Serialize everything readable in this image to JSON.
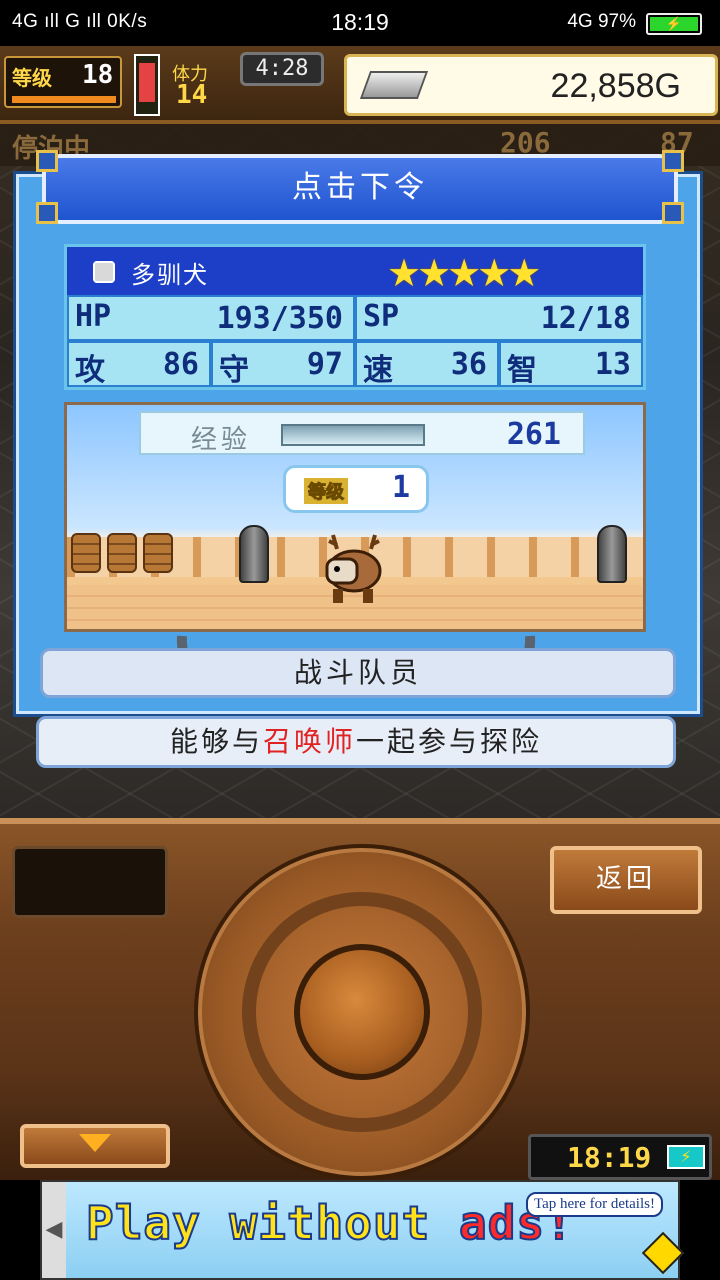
{
  "status_bar": {
    "left": "4G ıll G ıll 0K/s",
    "time": "18:19",
    "right": "4G 97%",
    "battery_icon": "battery-charging-icon"
  },
  "hud": {
    "level_label": "等级",
    "level": "18",
    "stamina_label": "体力",
    "stamina": "14",
    "timer": "4:28",
    "gold": "22,858G",
    "sub_left": "停泊中",
    "sub_mid": "206",
    "sub_right": "87"
  },
  "dialog": {
    "title": "点击下令",
    "unit_name": "多驯犬",
    "stars": "★★★★★",
    "stats": {
      "hp_label": "HP",
      "hp": "193/350",
      "sp_label": "SP",
      "sp": "12/18",
      "atk_label": "攻",
      "atk": "86",
      "def_label": "守",
      "def": "97",
      "spd_label": "速",
      "spd": "36",
      "int_label": "智",
      "int": "13"
    },
    "exp_label": "经验",
    "exp_value": "261",
    "level_label": "等级",
    "level_value": "1",
    "role": "战斗队员",
    "description_pre": "能够与",
    "description_highlight": "召唤师",
    "description_post": "一起参与探险"
  },
  "controller": {
    "back_label": "返回",
    "clock": "18:19"
  },
  "ad": {
    "text_main": "Play without ",
    "text_ads": "ads!",
    "tap": "Tap here for details!"
  },
  "colors": {
    "dialog_bg": "#4ea4e8",
    "title_bg": "#1f54d0",
    "highlight_red": "#e02222",
    "gold_yellow": "#ffd84a"
  }
}
